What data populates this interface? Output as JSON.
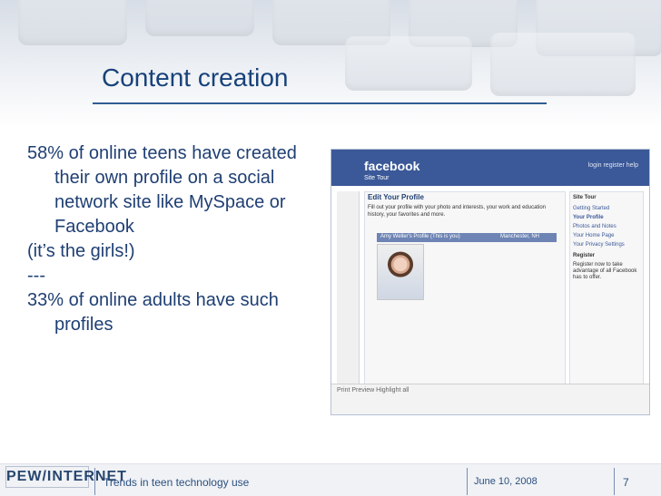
{
  "slide": {
    "title": "Content creation",
    "bullets": [
      "58% of online teens have created their own profile on a social network site like MySpace or Facebook",
      "(it’s the girls!)",
      "---",
      "33% of online adults have such profiles"
    ]
  },
  "screenshot": {
    "brand": "facebook",
    "site_tour": "Site Tour",
    "nav": "login   register   help",
    "edit_profile": "Edit Your Profile",
    "edit_text": "Fill out your profile with your photo and interests, your work and education history, your favorites and more.",
    "profile_header": "Amy Weller's Profile (This is you)",
    "profile_location": "Manchester, NH",
    "sidebar": [
      "Site Tour",
      "Getting Started",
      "Your Profile",
      "Photos and Notes",
      "Your Home Page",
      "Your Privacy Settings",
      "Register"
    ],
    "register_text": "Register now to take advantage of all Facebook has to offer.",
    "bottom_bar": "Print  Preview  Highlight all"
  },
  "footer": {
    "logo": "PEW/INTERNET",
    "text": "Trends in teen technology use",
    "date": "June 10, 2008",
    "page": "7"
  }
}
